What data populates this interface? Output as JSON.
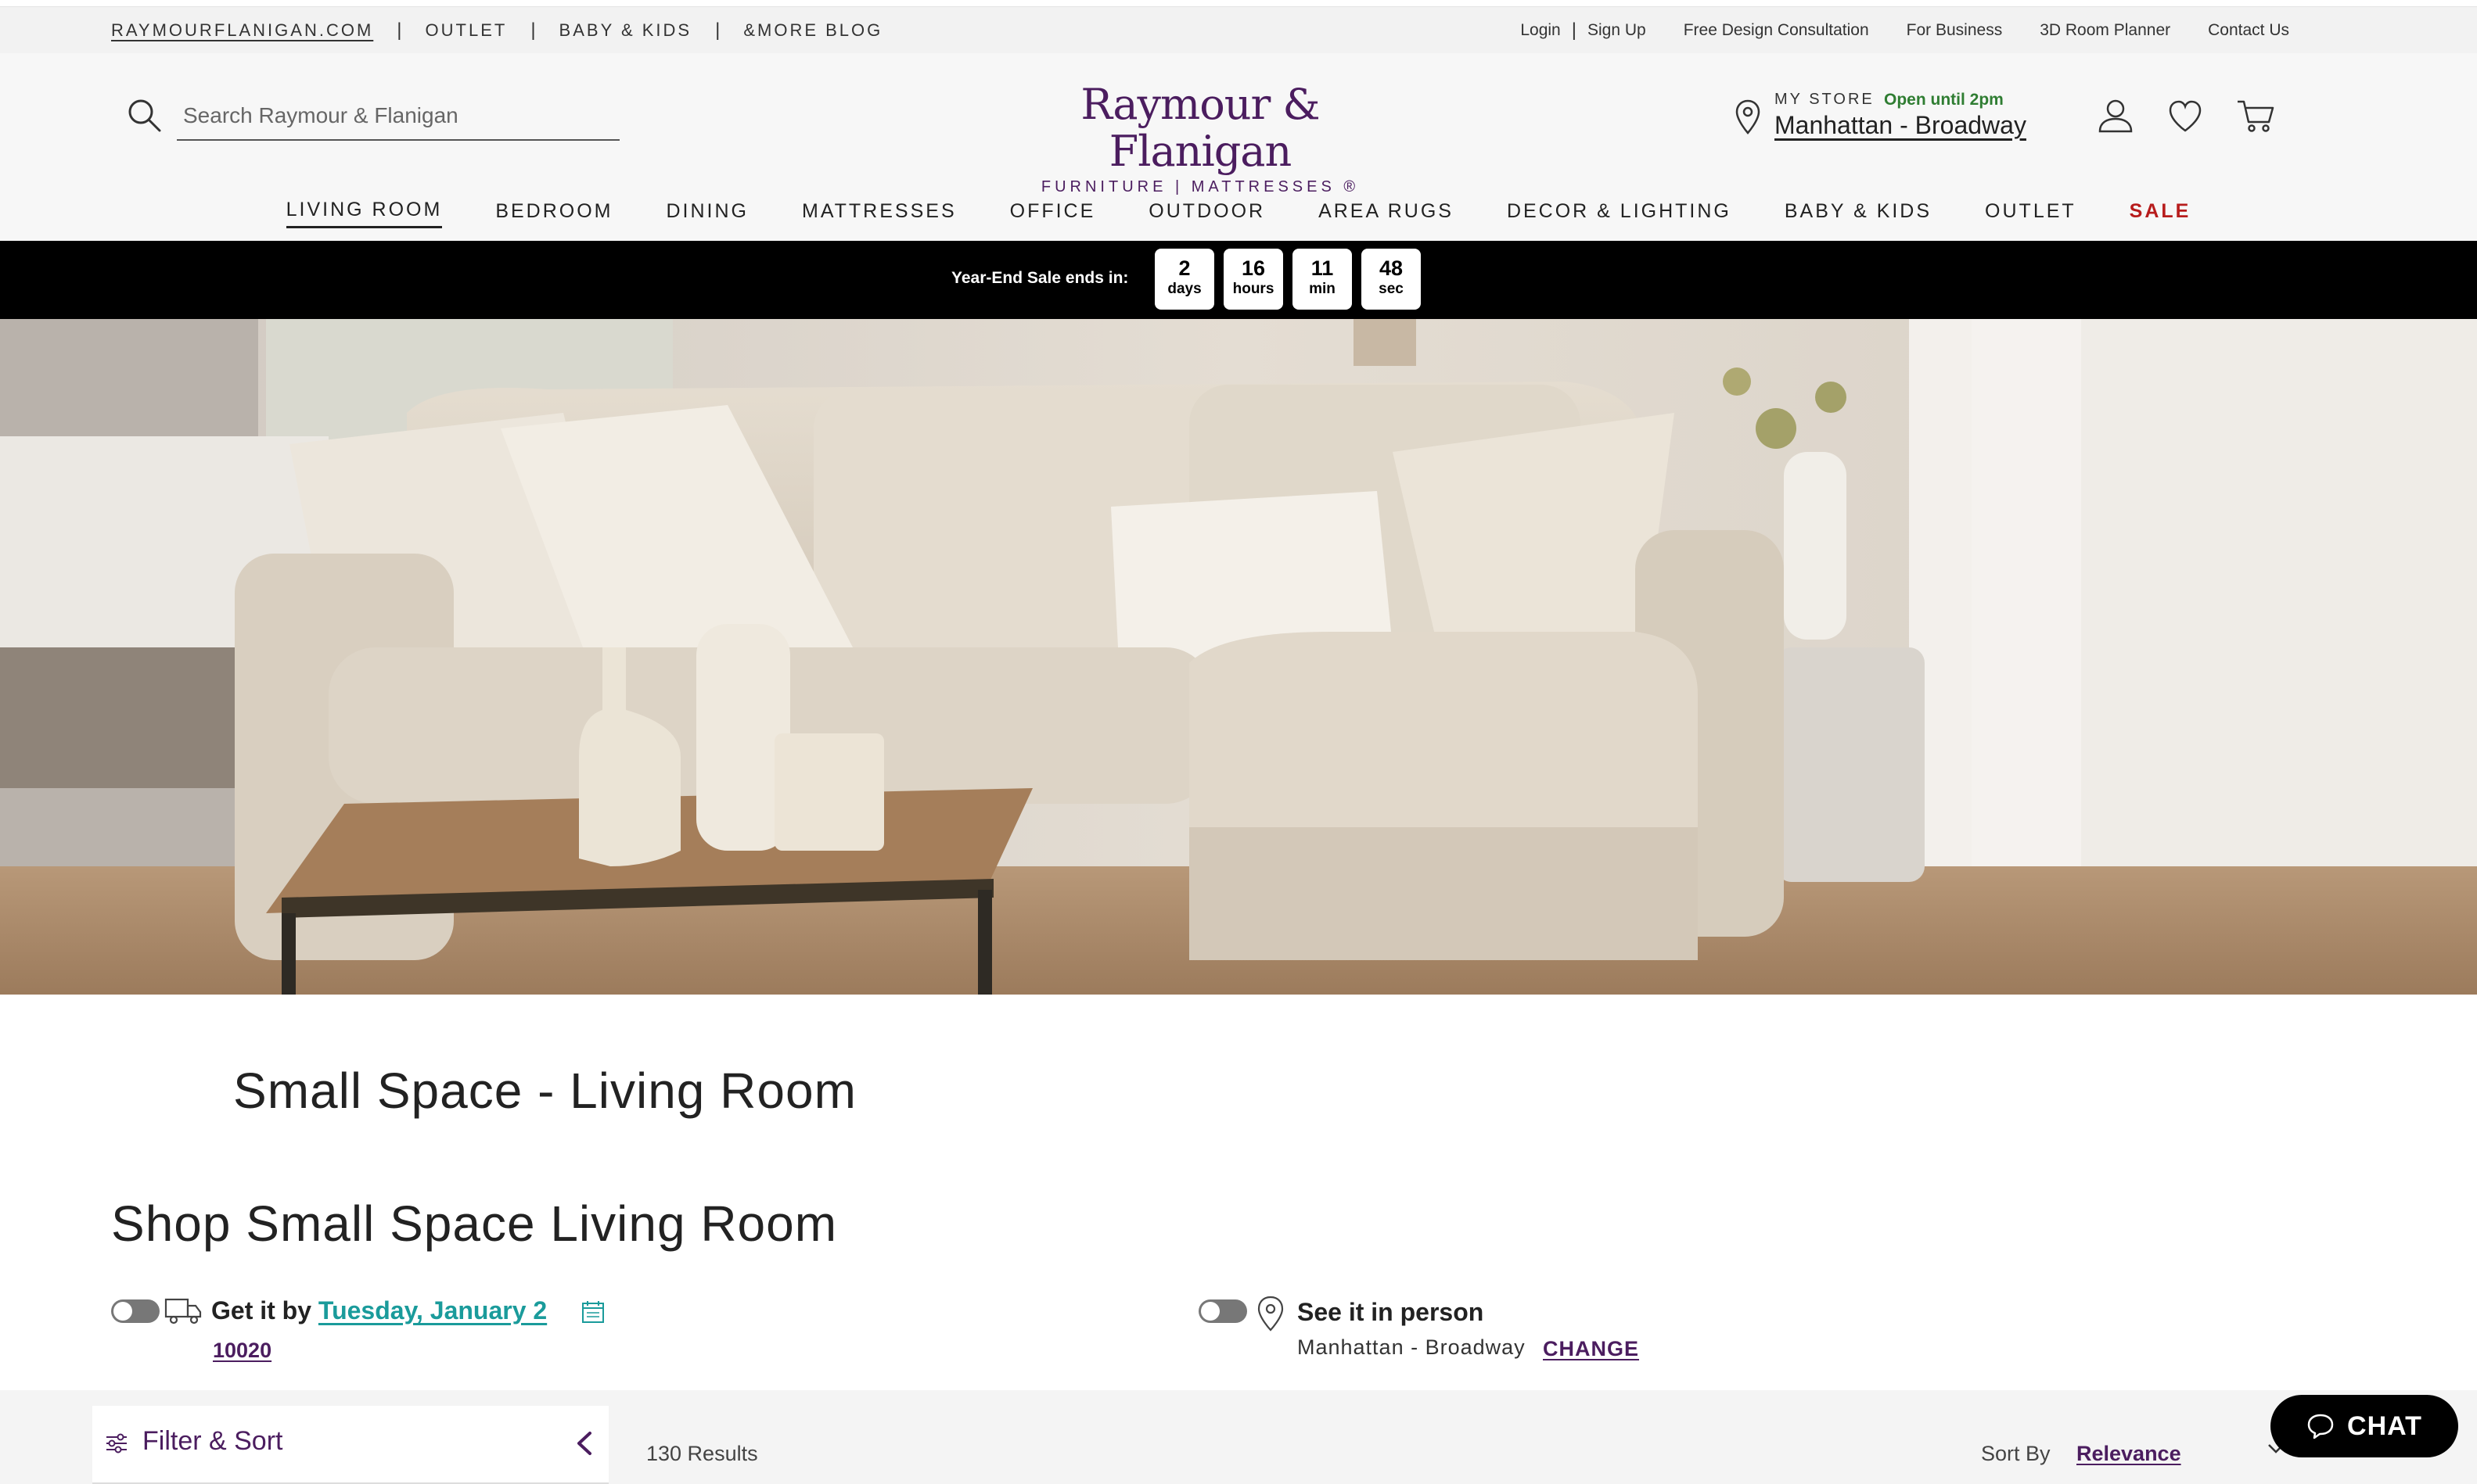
{
  "utility_bar": {
    "left_links": [
      "RAYMOURFLANIGAN.COM",
      "OUTLET",
      "BABY & KIDS",
      "&MORE BLOG"
    ],
    "login": "Login",
    "signup": "Sign Up",
    "right_links": [
      "Free Design Consultation",
      "For Business",
      "3D Room Planner",
      "Contact Us"
    ]
  },
  "header": {
    "search_placeholder": "Search Raymour & Flanigan",
    "logo_main": "Raymour & Flanigan",
    "logo_sub": "FURNITURE | MATTRESSES ®",
    "store_label": "MY STORE",
    "store_hours": "Open until 2pm",
    "store_name": "Manhattan - Broadway"
  },
  "nav": {
    "items": [
      "LIVING ROOM",
      "BEDROOM",
      "DINING",
      "MATTRESSES",
      "OFFICE",
      "OUTDOOR",
      "AREA RUGS",
      "DECOR & LIGHTING",
      "BABY & KIDS",
      "OUTLET",
      "SALE"
    ],
    "active": "LIVING ROOM",
    "sale_color": "#b71c1c"
  },
  "countdown": {
    "label": "Year-End Sale ends in:",
    "units": [
      {
        "value": "2",
        "unit": "days"
      },
      {
        "value": "16",
        "unit": "hours"
      },
      {
        "value": "11",
        "unit": "min"
      },
      {
        "value": "48",
        "unit": "sec"
      }
    ]
  },
  "page": {
    "title": "Small Space - Living Room",
    "shop_title": "Shop Small Space Living Room"
  },
  "fulfillment": {
    "delivery_prefix": "Get it by",
    "delivery_date": "Tuesday, January 2",
    "zip": "10020",
    "pickup_label": "See it in person",
    "pickup_store": "Manhattan - Broadway",
    "change_label": "CHANGE"
  },
  "results": {
    "filter_label": "Filter & Sort",
    "count": "130 Results",
    "sort_label": "Sort By",
    "sort_value": "Relevance"
  },
  "chat": {
    "label": "CHAT"
  },
  "colors": {
    "brand": "#4b1d5f",
    "teal_link": "#1a9b9b",
    "open_green": "#2f7d32"
  }
}
